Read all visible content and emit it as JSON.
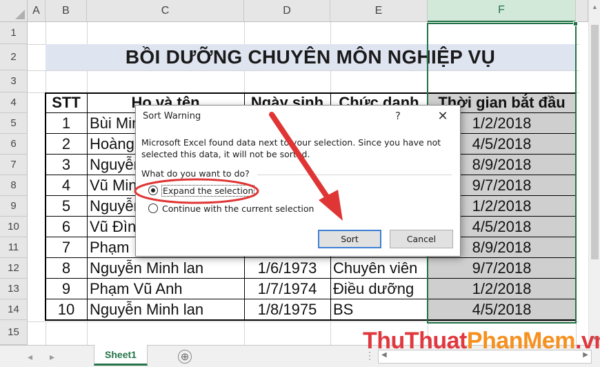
{
  "columns": [
    "A",
    "B",
    "C",
    "D",
    "E",
    "F"
  ],
  "rows": [
    "1",
    "2",
    "3",
    "4",
    "5",
    "6",
    "7",
    "8",
    "9",
    "10",
    "11",
    "12",
    "13",
    "14",
    "15"
  ],
  "title": "BỒI DƯỠNG CHUYÊN MÔN NGHIỆP VỤ",
  "table": {
    "headers": [
      "STT",
      "Họ và tên",
      "Ngày sinh",
      "Chức danh",
      "Thời gian bắt đầu"
    ],
    "rows": [
      [
        "1",
        "Bùi Minh",
        "",
        "",
        "1/2/2018"
      ],
      [
        "2",
        "Hoàng",
        "",
        "",
        "4/5/2018"
      ],
      [
        "3",
        "Nguyễn",
        "",
        "",
        "8/9/2018"
      ],
      [
        "4",
        "Vũ Minh",
        "",
        "",
        "9/7/2018"
      ],
      [
        "5",
        "Nguyễn",
        "",
        "",
        "1/2/2018"
      ],
      [
        "6",
        "Vũ Đình",
        "",
        "",
        "4/5/2018"
      ],
      [
        "7",
        "Phạm",
        "",
        "",
        "8/9/2018"
      ],
      [
        "8",
        "Nguyễn Minh lan",
        "1/6/1973",
        "Chuyên viên",
        "9/7/2018"
      ],
      [
        "9",
        "Phạm Vũ Anh",
        "1/7/1974",
        "Điều dưỡng",
        "1/2/2018"
      ],
      [
        "10",
        "Nguyễn Minh lan",
        "1/8/1975",
        "BS",
        "4/5/2018"
      ]
    ]
  },
  "selected_column": "F",
  "sheet_tabs": [
    "Sheet1"
  ],
  "add_sheet_symbol": "⊕",
  "dialog": {
    "title": "Sort Warning",
    "help": "?",
    "close": "✕",
    "message": "Microsoft Excel found data next to your selection.  Since you have not selected this data, it will not be sorted.",
    "question": "What do you want to do?",
    "options": [
      "Expand the selection",
      "Continue with the current selection"
    ],
    "selected_option": 0,
    "sort_button": "Sort",
    "cancel_button": "Cancel"
  },
  "annotation_color": "#e03535",
  "watermark": {
    "part1": "ThuThuat",
    "part2": "PhanMem",
    "part3": ".vn"
  },
  "colors": {
    "excel_green": "#217346",
    "title_band": "#dfe4f1",
    "selection_shade": "#cfcfcf"
  }
}
